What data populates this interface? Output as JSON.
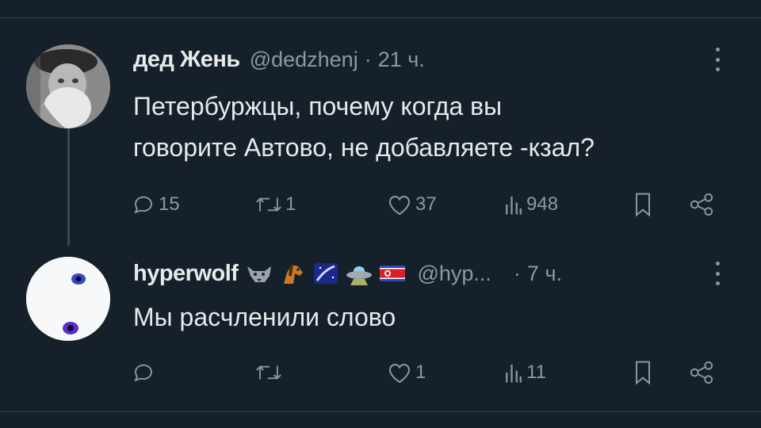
{
  "tweets": [
    {
      "author_name": "дед Жень",
      "handle": "@dedzhenj",
      "separator": "·",
      "time": "21 ч.",
      "text_lines": [
        "Петербуржцы, почему когда вы",
        "говорите Автово, не добавляете -кзал?"
      ],
      "avatar": "old-man-photo",
      "actions": {
        "replies": "15",
        "retweets": "1",
        "likes": "37",
        "views": "948"
      }
    },
    {
      "author_name": "hyperwolf",
      "emojis": [
        "wolf-emoji",
        "horse-emoji",
        "galaxy-emoji",
        "ufo-emoji",
        "north-korea-flag-emoji"
      ],
      "handle": "@hyp...",
      "separator": "·",
      "time": "7 ч.",
      "text_lines": [
        "Мы расчленили слово"
      ],
      "avatar": "wolf-eyes-photo",
      "actions": {
        "replies": "",
        "retweets": "",
        "likes": "1",
        "views": "11"
      }
    }
  ],
  "icons": {
    "reply": "reply-icon",
    "retweet": "retweet-icon",
    "like": "like-icon",
    "views": "views-icon",
    "bookmark": "bookmark-icon",
    "share": "share-icon",
    "more": "more-icon"
  },
  "colors": {
    "background": "#15202b",
    "text": "#e7e9ea",
    "muted": "#8b98a5",
    "divider": "#2f3b47"
  }
}
